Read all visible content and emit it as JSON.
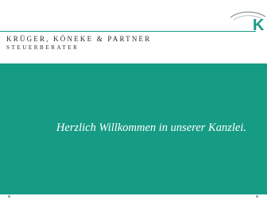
{
  "header": {
    "firm_name": "KRÜGER, KÖNEKE & PARTNER",
    "firm_subtitle": "STEUERBERATER",
    "logo_icon": "kkp-logo-icon",
    "logo_letter": "K"
  },
  "hero": {
    "welcome_text": "Herzlich Willkommen in unserer Kanzlei."
  },
  "colors": {
    "brand_teal": "#169b85",
    "rule_teal": "#1b9a85",
    "text_dark": "#2a2a2a"
  }
}
